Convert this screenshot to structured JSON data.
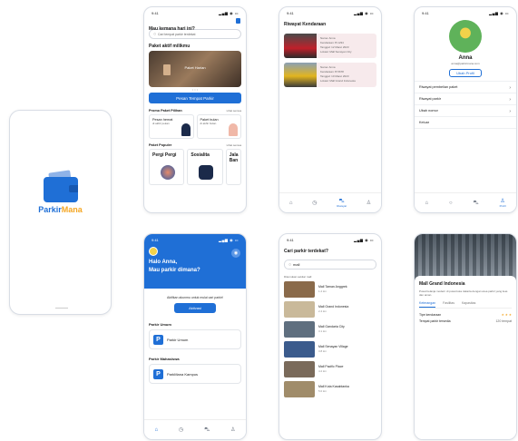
{
  "splash": {
    "logo_part1": "Parkir",
    "logo_part2": "Mana",
    "footer": ""
  },
  "home": {
    "status_time": "9:41",
    "status_icons": "▂▄▆ ◉ ▭",
    "greeting": "Mau kemana hari ini?",
    "search_placeholder": "Cari tempat parkir terdekat",
    "promo_header": "Paket aktif milikmu",
    "promo_label": "Paket Harian",
    "cta": "Pesan Tempat Parkir",
    "promo_section": "Promo Paket Pilihan",
    "see_all": "Lihat semua",
    "promo_cards": [
      {
        "title": "Pesan hemat",
        "sub": "di akhir pekan"
      },
      {
        "title": "Paket bulan",
        "sub": "di akhir bulan"
      }
    ],
    "popular_section": "Paket Populer",
    "popular": [
      "Pergi Pergi",
      "Sosialita",
      "Jala Ban"
    ]
  },
  "history": {
    "status_time": "9:41",
    "status_icons": "▂▄▆ ◉ ▭",
    "title": "Riwayat Kendaraan",
    "items": [
      {
        "l1": "Nama: Anna",
        "l2": "Kendaraan: B 1234",
        "l3": "Tanggal: 12 Maret 2023",
        "l4": "Lokasi: Mall Senayan City"
      },
      {
        "l1": "Nama: Anna",
        "l2": "Kendaraan: B 5678",
        "l3": "Tanggal: 10 Maret 2023",
        "l4": "Lokasi: Mall Grand Indonesia"
      }
    ],
    "active_tab": "Riwayat"
  },
  "profile": {
    "status_time": "9:41",
    "status_icons": "▂▄▆ ◉ ▭",
    "name": "Anna",
    "email": "anna@parkirmana.com",
    "edit": "Ubah Profil",
    "menu": [
      "Riwayat pembelian paket",
      "Riwayat parkir",
      "Ubah nomor",
      "Keluar"
    ],
    "active_tab": "Profil"
  },
  "welcome": {
    "status_time": "9:41",
    "status_icons": "▂▄▆ ◉ ▭",
    "hello": "Halo Anna,",
    "question": "Mau parkir dimana?",
    "activate_prompt": "Aktifkan akunmu untuk mulai cari parkir!",
    "activate_btn": "Aktivasi",
    "general_section": "Parkir Umum",
    "general_item": "Parkir Umum",
    "student_section": "Parkir Mahasiswa",
    "student_item": "ParkMana Kampus"
  },
  "search": {
    "status_time": "9:41",
    "status_icons": "▂▄▆ ◉ ▭",
    "title": "Cari parkir terdekat?",
    "query": "mall",
    "results_label": "Ditemukan sekitar mall",
    "results": [
      {
        "name": "Mall Taman Anggrek",
        "sub": "1.2 km"
      },
      {
        "name": "Mall Grand Indonesia",
        "sub": "2.4 km"
      },
      {
        "name": "Mall Gandaria City",
        "sub": "3.1 km"
      },
      {
        "name": "Mall Senayan Village",
        "sub": "3.8 km"
      },
      {
        "name": "Mall Pacific Place",
        "sub": "4.2 km"
      },
      {
        "name": "Mall Kota Kasablanka",
        "sub": "5.0 km"
      }
    ]
  },
  "detail": {
    "title": "Mall Grand Indonesia",
    "desc": "Pusat belanja modern di pusat kota Jakarta dengan area parkir yang luas dan aman.",
    "tabs": [
      "Keterangan",
      "Fasilitas",
      "Kapasitas"
    ],
    "rows": [
      {
        "label": "Tipe kendaraan",
        "value": "★ ★ ★"
      },
      {
        "label": "Tempat parkir tersedia",
        "value": "120 tempat"
      }
    ]
  },
  "colors": {
    "primary": "#1f6fd6",
    "accent": "#f4a623"
  }
}
